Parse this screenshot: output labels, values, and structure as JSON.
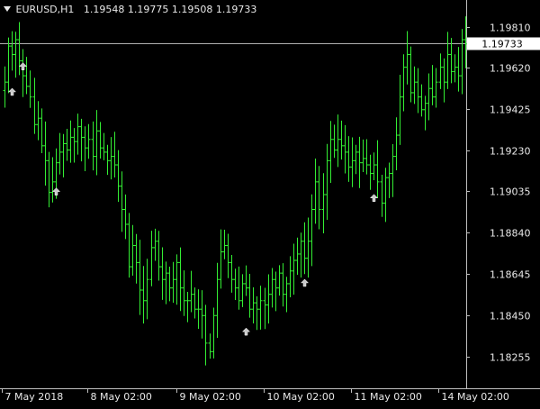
{
  "header": {
    "symbol": "EURUSD,H1",
    "open": "1.19548",
    "high": "1.19775",
    "low": "1.19508",
    "close": "1.19733"
  },
  "colors": {
    "background": "#000000",
    "candle": "#33ee33",
    "arrow": "#c8c8c8",
    "axis": "#c0c0c0",
    "text": "#e8e8e8",
    "price_line": "#b0b0b0",
    "price_tag_bg": "#ffffff",
    "price_tag_text": "#000000"
  },
  "chart_data": {
    "type": "candlestick",
    "ylim": [
      1.1812,
      1.1992
    ],
    "y_ticks": [
      "1.19810",
      "1.19620",
      "1.19425",
      "1.19230",
      "1.19035",
      "1.18840",
      "1.18645",
      "1.18450",
      "1.18255"
    ],
    "x_ticks": [
      "7 May 2018",
      "8 May 02:00",
      "9 May 02:00",
      "10 May 02:00",
      "11 May 02:00",
      "14 May 02:00"
    ],
    "current_price": "1.19733",
    "grid": false,
    "series": [
      {
        "closes": [
          1.1955,
          1.1972,
          1.1968,
          1.1975,
          1.1965,
          1.1958,
          1.1953,
          1.1948,
          1.1935,
          1.1938,
          1.1925,
          1.1918,
          1.1903,
          1.1908,
          1.1917,
          1.1922,
          1.1926,
          1.1923,
          1.1929,
          1.1927,
          1.1934,
          1.1929,
          1.1924,
          1.1928,
          1.192,
          1.1932,
          1.1924,
          1.1922,
          1.1918,
          1.192,
          1.1916,
          1.1906,
          1.1895,
          1.1888,
          1.1868,
          1.1878,
          1.187,
          1.1857,
          1.1852,
          1.1862,
          1.1877,
          1.188,
          1.1868,
          1.1862,
          1.1865,
          1.1858,
          1.1862,
          1.187,
          1.1858,
          1.1852,
          1.1852,
          1.1855,
          1.1848,
          1.1848,
          1.1845,
          1.1832,
          1.1828,
          1.1845,
          1.1862,
          1.1875,
          1.1878,
          1.187,
          1.1862,
          1.1858,
          1.1852,
          1.186,
          1.1858,
          1.1848,
          1.1851,
          1.1848,
          1.1852,
          1.185,
          1.1855,
          1.1862,
          1.1858,
          1.1865,
          1.1855,
          1.186,
          1.1866,
          1.1871,
          1.1874,
          1.188,
          1.1872,
          1.188,
          1.1895,
          1.1908,
          1.1895,
          1.1902,
          1.1918,
          1.1928,
          1.1923,
          1.1928,
          1.1925,
          1.1922,
          1.1915,
          1.1918,
          1.1922,
          1.1917,
          1.1919,
          1.1916,
          1.1912,
          1.1916,
          1.1908,
          1.1898,
          1.191,
          1.1912,
          1.192,
          1.193,
          1.1948,
          1.1962,
          1.1968,
          1.195,
          1.1955,
          1.1948,
          1.1942,
          1.1945,
          1.1952,
          1.1948,
          1.1955,
          1.1962,
          1.1955,
          1.1968,
          1.196,
          1.1962,
          1.1958,
          1.1975,
          1.1973
        ]
      },
      {
        "arrows_up": [
          [
            2,
            1.195
          ],
          [
            5,
            1.1962
          ],
          [
            14,
            1.1903
          ],
          [
            66,
            1.1837
          ],
          [
            82,
            1.186
          ],
          [
            101,
            1.19
          ]
        ]
      }
    ]
  }
}
